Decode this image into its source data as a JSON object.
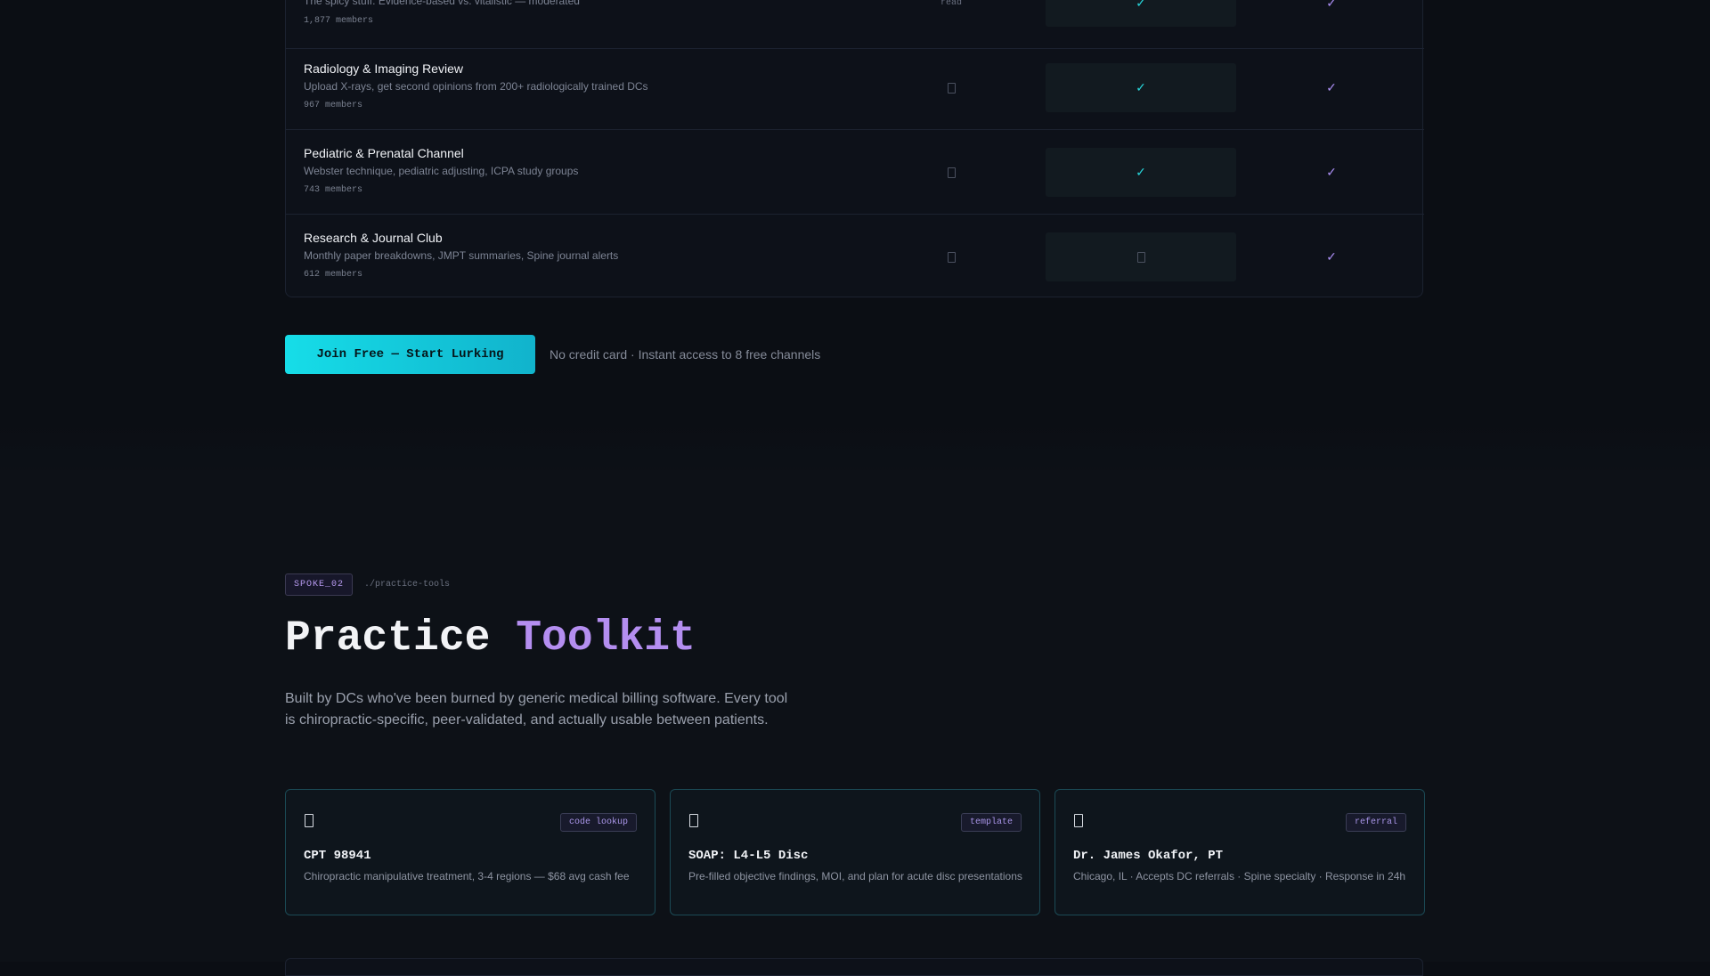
{
  "channels_table": {
    "rows": [
      {
        "name": "",
        "description": "The spicy stuff. Evidence-based vs. vitalistic — moderated",
        "members": "1,877 members",
        "free": "read",
        "pro": "check",
        "elite": "check"
      },
      {
        "name": "Radiology & Imaging Review",
        "description": "Upload X-rays, get second opinions from 200+ radiologically trained DCs",
        "members": "967 members",
        "free": "none",
        "pro": "check",
        "elite": "check"
      },
      {
        "name": "Pediatric & Prenatal Channel",
        "description": "Webster technique, pediatric adjusting, ICPA study groups",
        "members": "743 members",
        "free": "none",
        "pro": "check",
        "elite": "check"
      },
      {
        "name": "Research & Journal Club",
        "description": "Monthly paper breakdowns, JMPT summaries, Spine journal alerts",
        "members": "612 members",
        "free": "none",
        "pro": "none",
        "elite": "check"
      }
    ],
    "check_glyph": "✓",
    "read_label": "read",
    "colors": {
      "pro_check": "#27d3d8",
      "elite_check": "#a88cf0"
    }
  },
  "cta": {
    "button_label": "Join Free — Start Lurking",
    "note": "No credit card · Instant access to 8 free channels"
  },
  "toolkit": {
    "badge": "SPOKE_02",
    "path": "./practice-tools",
    "title_main": "Practice ",
    "title_accent": "Toolkit",
    "intro": "Built by DCs who've been burned by generic medical billing software. Every tool is chiropractic-specific, peer-validated, and actually usable between patients.",
    "cards": [
      {
        "icon": "document-icon",
        "tag": "code lookup",
        "title": "CPT 98941",
        "description": "Chiropractic manipulative treatment, 3-4 regions — $68 avg cash fee"
      },
      {
        "icon": "document-icon",
        "tag": "template",
        "title": "SOAP: L4-L5 Disc",
        "description": "Pre-filled objective findings, MOI, and plan for acute disc presentations"
      },
      {
        "icon": "document-icon",
        "tag": "referral",
        "title": "Dr. James Okafor, PT",
        "description": "Chicago, IL · Accepts DC referrals · Spine specialty · Response in 24h"
      }
    ],
    "accent_color": "#b48ef0"
  }
}
